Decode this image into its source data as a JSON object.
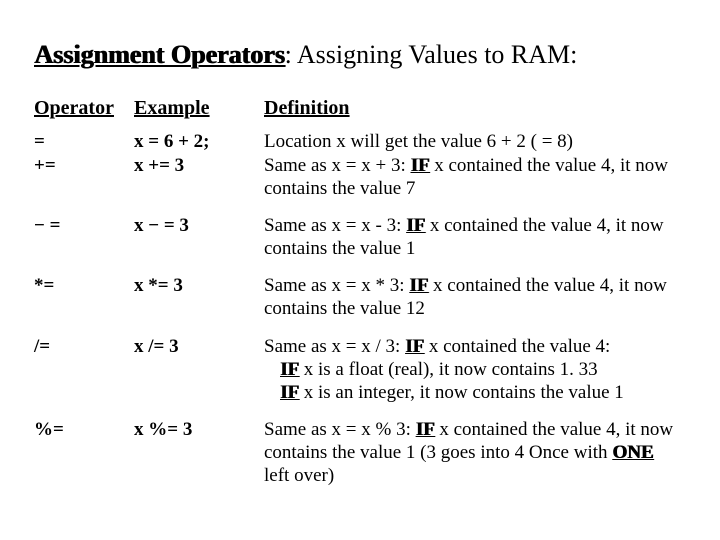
{
  "title": {
    "bold": "Assignment Operators",
    "rest": ": Assigning Values to RAM:"
  },
  "headers": {
    "operator": "Operator",
    "example": "Example",
    "definition": "Definition"
  },
  "rows": [
    {
      "op": "=",
      "ex": "x = 6 + 2;",
      "def_pre": "Location x will get the value 6 + 2 ( = 8)",
      "def_if": "",
      "def_post": "",
      "combine_next": true
    },
    {
      "op": "+=",
      "ex": "x += 3",
      "def_pre": "Same as x = x + 3: ",
      "def_if": "IF",
      "def_post": " x contained the value 4, it now contains the value 7"
    },
    {
      "op": "− =",
      "ex": "x − = 3",
      "def_pre": "Same as x = x - 3: ",
      "def_if": "IF",
      "def_post": " x contained the value 4, it now contains the value 1"
    },
    {
      "op": "*=",
      "ex": "x *= 3",
      "def_pre": "Same as x = x * 3: ",
      "def_if": "IF",
      "def_post": " x contained the value 4, it now contains the value 12"
    },
    {
      "op": "/=",
      "ex": "x /= 3",
      "def_pre": "Same as x = x / 3: ",
      "def_if": "IF",
      "def_post": " x contained the value 4:",
      "sublines": [
        {
          "if": "IF",
          "rest": " x is a float (real), it now contains 1. 33"
        },
        {
          "if": "IF",
          "rest": " x is an integer, it now contains the value 1"
        }
      ]
    },
    {
      "op": "%=",
      "ex": "x %= 3",
      "def_pre": "Same as x = x % 3: ",
      "def_if": "IF",
      "def_post": " x contained the value 4, it now contains the value 1 (3 goes into 4 Once with ",
      "one": "ONE",
      "tail": " left over)"
    }
  ],
  "chart_data": {
    "type": "table",
    "title": "Assignment Operators: Assigning Values to RAM",
    "columns": [
      "Operator",
      "Example",
      "Definition"
    ],
    "rows": [
      [
        "=",
        "x = 6 + 2;",
        "Location x will get the value 6 + 2 ( = 8)"
      ],
      [
        "+=",
        "x += 3",
        "Same as x = x + 3: IF x contained the value 4, it now contains the value 7"
      ],
      [
        "-=",
        "x -= 3",
        "Same as x = x - 3: IF x contained the value 4, it now contains the value 1"
      ],
      [
        "*=",
        "x *= 3",
        "Same as x = x * 3: IF x contained the value 4, it now contains the value 12"
      ],
      [
        "/=",
        "x /= 3",
        "Same as x = x / 3: IF x contained the value 4: IF x is a float (real), it now contains 1.33; IF x is an integer, it now contains the value 1"
      ],
      [
        "%=",
        "x %= 3",
        "Same as x = x % 3: IF x contained the value 4, it now contains the value 1 (3 goes into 4 Once with ONE left over)"
      ]
    ]
  }
}
